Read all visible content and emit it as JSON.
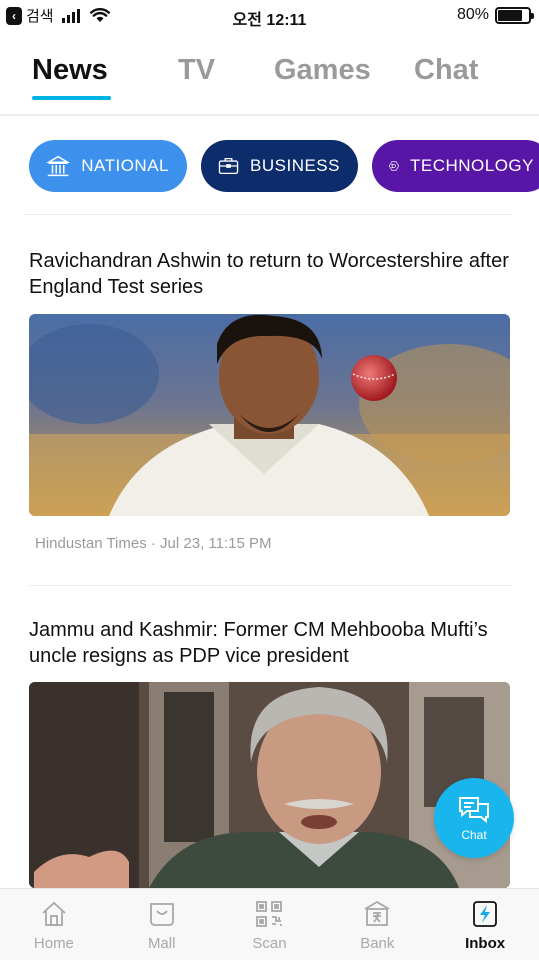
{
  "status_bar": {
    "carrier": "검색",
    "time": "오전 12:11",
    "battery": "80%",
    "battery_level": 0.8
  },
  "tabs": [
    {
      "label": "News",
      "active": true
    },
    {
      "label": "TV",
      "active": false
    },
    {
      "label": "Games",
      "active": false
    },
    {
      "label": "Chat",
      "active": false
    }
  ],
  "categories": [
    {
      "label": "NATIONAL",
      "icon": "monument-icon",
      "color": "#3d91ec"
    },
    {
      "label": "BUSINESS",
      "icon": "briefcase-icon",
      "color": "#0d2c6b"
    },
    {
      "label": "TECHNOLOGY",
      "icon": "chip-icon",
      "color": "#5816a6"
    }
  ],
  "articles": [
    {
      "headline": "Ravichandran Ashwin to return to Worcestershire after England Test series",
      "source": "Hindustan Times · Jul 23, 11:15 PM"
    },
    {
      "headline": "Jammu and Kashmir: Former CM Mehbooba Mufti’s uncle resigns as PDP vice president"
    }
  ],
  "chat_fab": {
    "label": "Chat"
  },
  "bottom_nav": [
    {
      "label": "Home",
      "icon": "home-icon",
      "active": false
    },
    {
      "label": "Mall",
      "icon": "bag-icon",
      "active": false
    },
    {
      "label": "Scan",
      "icon": "qr-code-icon",
      "active": false
    },
    {
      "label": "Bank",
      "icon": "bank-icon",
      "active": false
    },
    {
      "label": "Inbox",
      "icon": "inbox-icon",
      "active": true
    }
  ],
  "colors": {
    "accent": "#00b4e6",
    "chat_fab": "#19b6ee"
  }
}
